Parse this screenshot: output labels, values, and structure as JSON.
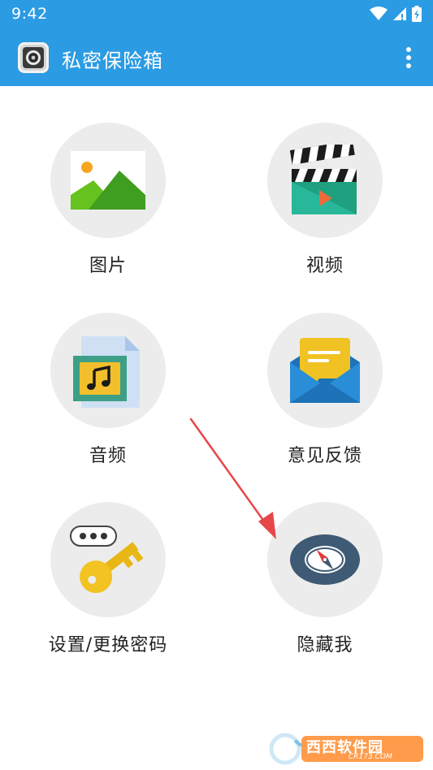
{
  "status_bar": {
    "time": "9:42",
    "icons": [
      "wifi-icon",
      "cell-signal-icon",
      "battery-charging-icon"
    ]
  },
  "app_bar": {
    "title": "私密保险箱",
    "logo_icon": "safe-lock-icon",
    "menu_icon": "more-vert-icon",
    "background_color": "#2b9be3"
  },
  "grid": {
    "items": [
      {
        "label": "图片",
        "icon": "image-icon"
      },
      {
        "label": "视频",
        "icon": "clapperboard-icon"
      },
      {
        "label": "音频",
        "icon": "music-file-icon"
      },
      {
        "label": "意见反馈",
        "icon": "envelope-icon"
      },
      {
        "label": "设置/更换密码",
        "icon": "key-password-icon"
      },
      {
        "label": "隐藏我",
        "icon": "compass-icon"
      }
    ]
  },
  "annotation": {
    "arrow_color": "#e8474a",
    "points_to": "隐藏我"
  },
  "watermark": {
    "brand": "西西软件园",
    "url": "CR173.COM"
  }
}
